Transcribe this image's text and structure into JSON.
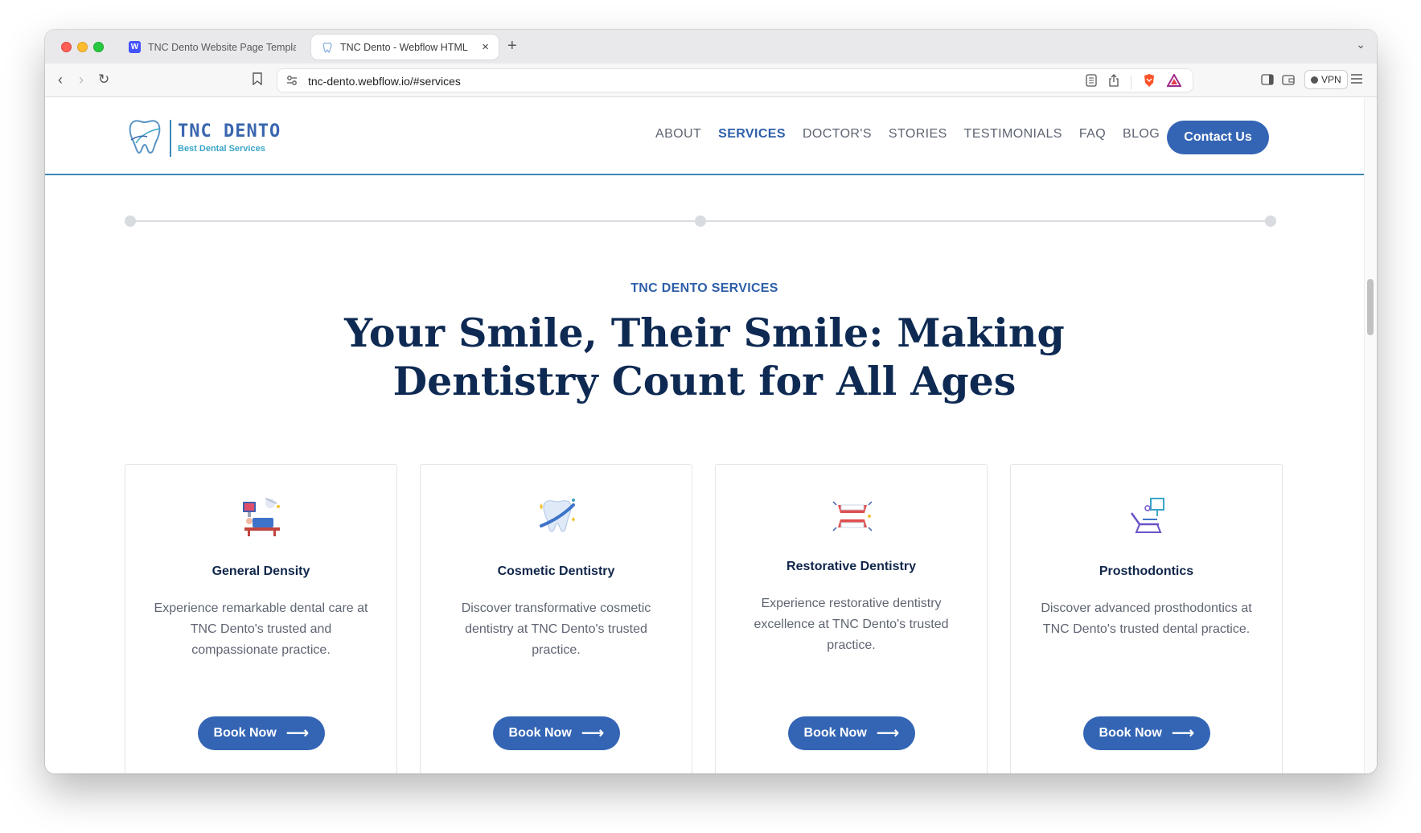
{
  "browser": {
    "tabs": [
      {
        "label": "TNC Dento Website Page Template",
        "favicon": "webflow-icon"
      },
      {
        "label": "TNC Dento - Webflow HTML website template",
        "favicon": "tooth-icon",
        "active": true
      }
    ],
    "new_tab": "+",
    "url": "tnc-dento.webflow.io/#services",
    "vpn_label": "VPN"
  },
  "site": {
    "logo": {
      "name": "TNC DENTO",
      "tagline": "Best Dental Services"
    },
    "nav": [
      "ABOUT",
      "SERVICES",
      "DOCTOR'S",
      "STORIES",
      "TESTIMONIALS",
      "FAQ",
      "BLOG"
    ],
    "active_nav": "SERVICES",
    "contact_label": "Contact Us"
  },
  "services": {
    "eyebrow": "TNC DENTO SERVICES",
    "headline_line1": "Your Smile, Their Smile: Making",
    "headline_line2": "Dentistry Count for All Ages",
    "cards": [
      {
        "title": "General Density",
        "description": "Experience remarkable dental care at TNC Dento's trusted and compassionate practice.",
        "button": "Book Now",
        "icon": "dental-chair-office-icon"
      },
      {
        "title": "Cosmetic Dentistry",
        "description": "Discover transformative cosmetic dentistry at TNC Dento's trusted practice.",
        "button": "Book Now",
        "icon": "sparkling-tooth-icon"
      },
      {
        "title": "Restorative Dentistry",
        "description": "Experience restorative dentistry excellence at TNC Dento's trusted practice.",
        "button": "Book Now",
        "icon": "denture-icon"
      },
      {
        "title": "Prosthodontics",
        "description": "Discover advanced prosthodontics at TNC Dento's trusted dental practice.",
        "button": "Book Now",
        "icon": "dental-chair-icon"
      }
    ]
  },
  "colors": {
    "primary": "#3465b5",
    "heading": "#0e2a53",
    "accent": "#3b87b8"
  }
}
